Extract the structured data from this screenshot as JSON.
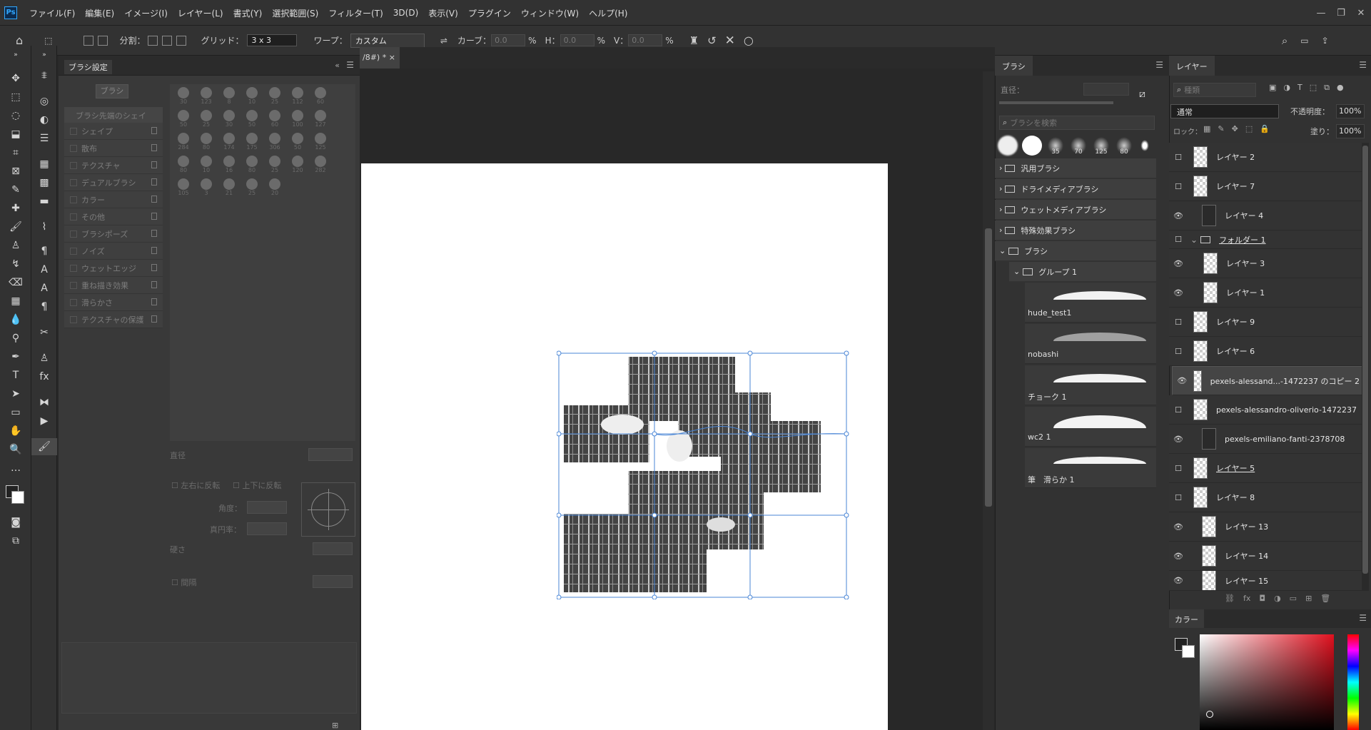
{
  "app": {
    "logo": "Ps",
    "menus": [
      "ファイル(F)",
      "編集(E)",
      "イメージ(I)",
      "レイヤー(L)",
      "書式(Y)",
      "選択範囲(S)",
      "フィルター(T)",
      "3D(D)",
      "表示(V)",
      "プラグイン",
      "ウィンドウ(W)",
      "ヘルプ(H)"
    ],
    "window_controls": [
      "—",
      "❐",
      "✕"
    ]
  },
  "options": {
    "split_label": "分割：",
    "grid_label": "グリッド：",
    "grid_value": "3 x 3",
    "warp_label": "ワープ：",
    "warp_value": "カスタム",
    "curve_label": "カーブ：",
    "curve_value": "0.0",
    "h_label": "H：",
    "h_value": "0.0",
    "v_label": "V：",
    "v_value": "0.0",
    "pct": "%"
  },
  "document": {
    "tab_title": "/8#) *",
    "tab_close": "×"
  },
  "brush_settings": {
    "title": "ブラシ設定",
    "brush_button": "ブラシ",
    "tip_shape": "ブラシ先端のシェイプ",
    "rows": [
      "シェイプ",
      "散布",
      "テクスチャ",
      "デュアルブラシ",
      "カラー",
      "その他",
      "ブラシポーズ",
      "ノイズ",
      "ウェットエッジ",
      "重ね描き効果",
      "滑らかさ",
      "テクスチャの保護"
    ],
    "tip_sizes": [
      "30",
      "123",
      "8",
      "10",
      "25",
      "112",
      "60",
      "50",
      "25",
      "30",
      "50",
      "60",
      "100",
      "127",
      "284",
      "80",
      "174",
      "175",
      "306",
      "50",
      "125",
      "80",
      "10",
      "16",
      "80",
      "25",
      "120",
      "282",
      "105",
      "3",
      "21",
      "25",
      "20"
    ],
    "size_label": "直径",
    "flip_x": "左右に反転",
    "flip_y": "上下に反転",
    "angle": "角度：",
    "roundness": "真円率：",
    "hardness": "硬さ",
    "spacing": "間隔"
  },
  "brushes": {
    "title": "ブラシ",
    "size_label": "直径：",
    "search_placeholder": "ブラシを検索",
    "preset_sizes": [
      "35",
      "70",
      "125",
      "80"
    ],
    "folders": [
      "汎用ブラシ",
      "ドライメディアブラシ",
      "ウェットメディアブラシ",
      "特殊効果ブラシ",
      "ブラシ"
    ],
    "group": "グループ 1",
    "items": [
      "hude_test1",
      "nobashi",
      "チョーク 1",
      "wc2 1",
      "筆　滑らか 1"
    ]
  },
  "layers": {
    "title": "レイヤー",
    "kind_placeholder": "種類",
    "blend_mode": "通常",
    "opacity_label": "不透明度：",
    "opacity": "100%",
    "lock_label": "ロック：",
    "fill_label": "塗り：",
    "fill": "100%",
    "items": [
      {
        "name": "レイヤー 2",
        "visible": false
      },
      {
        "name": "レイヤー 7",
        "visible": false
      },
      {
        "name": "レイヤー 4",
        "visible": true
      },
      {
        "name": "フォルダー 1",
        "visible": false
      },
      {
        "name": "レイヤー 3",
        "visible": true
      },
      {
        "name": "レイヤー 1",
        "visible": true
      },
      {
        "name": "レイヤー 9",
        "visible": false
      },
      {
        "name": "レイヤー 6",
        "visible": false
      },
      {
        "name": "pexels-alessand...-1472237 のコピー 2",
        "visible": true
      },
      {
        "name": "pexels-alessandro-oliverio-1472237",
        "visible": false
      },
      {
        "name": "pexels-emiliano-fanti-2378708",
        "visible": true
      },
      {
        "name": "レイヤー 5",
        "visible": false
      },
      {
        "name": "レイヤー 8",
        "visible": false
      },
      {
        "name": "レイヤー 13",
        "visible": true
      },
      {
        "name": "レイヤー 14",
        "visible": true
      },
      {
        "name": "レイヤー 15",
        "visible": true
      }
    ]
  },
  "color": {
    "title": "カラー",
    "accent": "#e0101e"
  }
}
